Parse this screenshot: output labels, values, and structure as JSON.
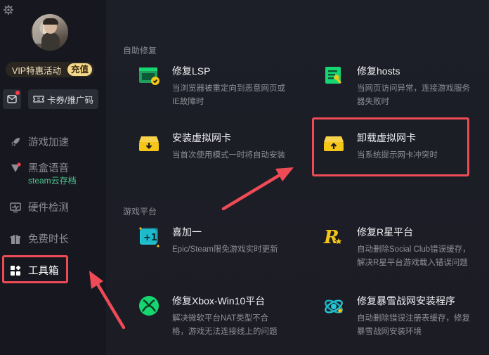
{
  "user": {
    "vip_label": "VIP特惠活动",
    "recharge_label": "充值"
  },
  "sidebar": {
    "coupon_label": "卡券/推广码",
    "items": [
      {
        "label": "游戏加速",
        "icon": "rocket-icon"
      },
      {
        "label": "黑盒语音",
        "sub": "steam云存档",
        "icon": "voice-icon"
      },
      {
        "label": "硬件检测",
        "icon": "monitor-icon"
      },
      {
        "label": "免费时长",
        "icon": "gift-icon"
      },
      {
        "label": "工具箱",
        "icon": "toolbox-icon",
        "active": true
      }
    ]
  },
  "main": {
    "section1_title": "自助修复",
    "section2_title": "游戏平台",
    "tools": [
      {
        "name": "修复LSP",
        "desc": "当浏览器被重定向到恶意网页或IE故障时",
        "icon": "browser-repair-icon"
      },
      {
        "name": "修复hosts",
        "desc": "当网页访问异常，连接游戏服务器失败时",
        "icon": "hosts-repair-icon"
      },
      {
        "name": "安装虚拟网卡",
        "desc": "当首次使用模式一时将自动安装",
        "icon": "install-adapter-icon"
      },
      {
        "name": "卸载虚拟网卡",
        "desc": "当系统提示网卡冲突时",
        "icon": "uninstall-adapter-icon"
      },
      {
        "name": "喜加一",
        "desc": "Epic/Steam限免游戏实时更新",
        "icon": "plus-one-icon"
      },
      {
        "name": "修复R星平台",
        "desc": "自动删除Social Club错误缓存，解决R星平台游戏载入错误问题",
        "icon": "rockstar-icon"
      },
      {
        "name": "修复Xbox-Win10平台",
        "desc": "解决微软平台NAT类型不合格，游戏无法连接线上的问题",
        "icon": "xbox-icon"
      },
      {
        "name": "修复暴雪战网安装程序",
        "desc": "自动删除错误注册表缓存，修复暴雪战网安装环境",
        "icon": "battlenet-icon"
      }
    ]
  },
  "colors": {
    "accent_red": "#ee4b57",
    "green": "#4ec48e",
    "yellow": "#f5c518"
  }
}
